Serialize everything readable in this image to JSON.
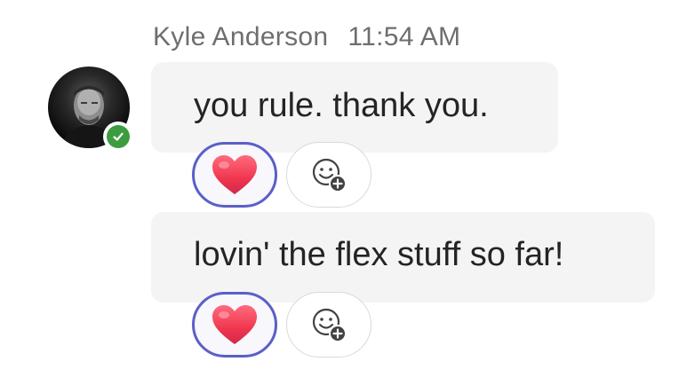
{
  "message_group": {
    "sender_name": "Kyle Anderson",
    "timestamp": "11:54 AM",
    "presence": "available",
    "presence_color": "#3c9c3f",
    "messages": [
      {
        "text": "you rule. thank you.",
        "reactions": [
          {
            "icon": "heart-icon",
            "emoji": "❤️",
            "selected": true
          },
          {
            "icon": "add-reaction-icon"
          }
        ]
      },
      {
        "text": "lovin' the flex stuff so far!",
        "reactions": [
          {
            "icon": "heart-icon",
            "emoji": "❤️",
            "selected": true
          },
          {
            "icon": "add-reaction-icon"
          }
        ]
      }
    ]
  },
  "colors": {
    "bubble_background": "#f4f4f4",
    "reaction_selected_border": "#5b5fc7",
    "text": "#242424",
    "secondary_text": "#6e6e6e"
  }
}
